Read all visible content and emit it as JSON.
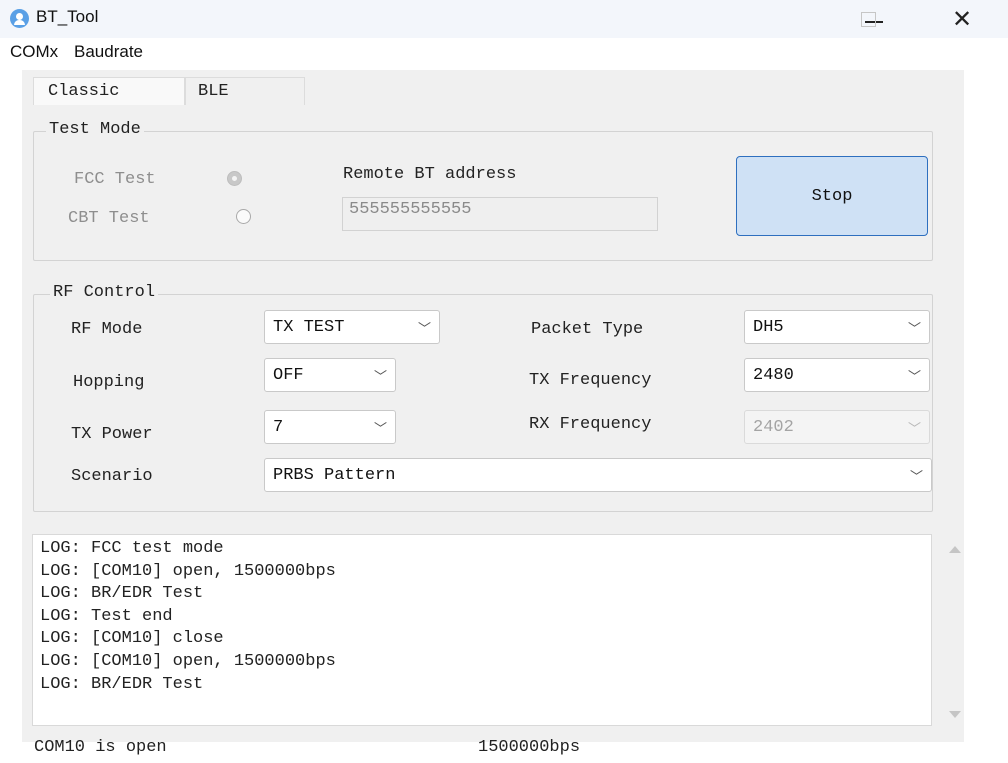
{
  "window": {
    "title": "BT_Tool"
  },
  "menu": {
    "items": [
      "COMx",
      "Baudrate"
    ]
  },
  "tabs": [
    {
      "label": "Classic",
      "active": true
    },
    {
      "label": "BLE",
      "active": false
    }
  ],
  "test_mode": {
    "title": "Test Mode",
    "options": [
      {
        "label": "FCC Test",
        "selected": true
      },
      {
        "label": "CBT Test",
        "selected": false
      }
    ],
    "remote_label": "Remote BT address",
    "remote_value": "555555555555",
    "stop_label": "Stop"
  },
  "rf_control": {
    "title": "RF Control",
    "rf_mode": {
      "label": "RF Mode",
      "value": "TX TEST"
    },
    "hopping": {
      "label": "Hopping",
      "value": "OFF"
    },
    "tx_power": {
      "label": "TX Power",
      "value": "7"
    },
    "scenario": {
      "label": "Scenario",
      "value": "PRBS Pattern"
    },
    "packet_type": {
      "label": "Packet Type",
      "value": "DH5"
    },
    "tx_frequency": {
      "label": "TX Frequency",
      "value": "2480"
    },
    "rx_frequency": {
      "label": "RX Frequency",
      "value": "2402"
    }
  },
  "log": [
    "LOG: FCC test mode",
    "LOG: [COM10] open, 1500000bps",
    "LOG: BR/EDR Test",
    "LOG: Test end",
    "LOG: [COM10] close",
    "LOG: [COM10] open, 1500000bps",
    "LOG: BR/EDR Test"
  ],
  "status": {
    "port": "COM10 is open",
    "baud": "1500000bps"
  },
  "icons": {
    "app": "bluetooth-user-icon",
    "minimize": "minimize-icon",
    "maximize": "maximize-icon",
    "close": "close-icon",
    "dropdown": "chevron-down-icon"
  },
  "colors": {
    "stop_button_bg": "#cfe1f5",
    "stop_button_border": "#2e6fbf",
    "panel_bg": "#f0f0f0"
  }
}
